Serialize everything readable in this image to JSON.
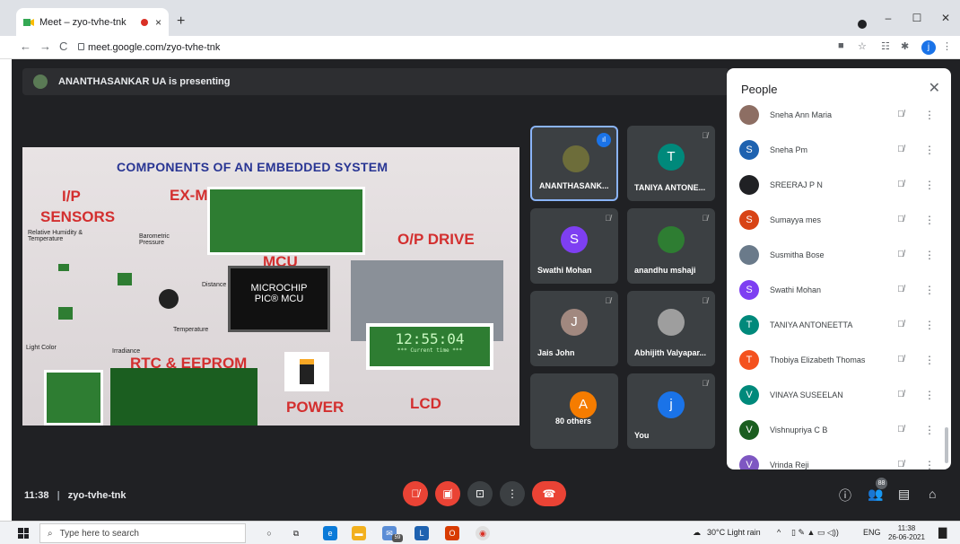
{
  "browser": {
    "tab_title": "Meet – zyo-tvhe-tnk",
    "tab_close": "×",
    "new_tab": "+",
    "url": "meet.google.com/zyo-tvhe-tnk",
    "profile_initial": "j",
    "win_min": "–",
    "win_max": "☐",
    "win_close": "✕"
  },
  "meeting": {
    "presenting_text": "ANANTHASANKAR UA is presenting",
    "time": "11:38",
    "code": "zyo-tvhe-tnk",
    "participants_badge": "88"
  },
  "slide": {
    "heading": "COMPONENTS OF AN EMBEDDED SYSTEM",
    "labels": {
      "ip": "I/P",
      "sensors": "SENSORS",
      "ex_modules": "EX-MODULES",
      "op_drive": "O/P DRIVE",
      "mcu": "MCU",
      "rtc": "RTC & EEPROM",
      "power": "POWER",
      "lcd": "LCD"
    },
    "small": {
      "humidity": "Relative Humidity & Temperature",
      "barometric": "Barometric Pressure",
      "distance": "Distance",
      "temperature": "Temperature",
      "light": "Light Color",
      "irradiance": "Irradiance"
    },
    "chip_brand": "MICROCHIP",
    "chip_name": "PIC® MCU",
    "lcd_time": "12:55:04",
    "lcd_sub": "*** Current time ***"
  },
  "tiles": [
    {
      "name": "ANANTHASANK...",
      "initial": "",
      "color": "#6d6d3a"
    },
    {
      "name": "TANIYA ANTONE...",
      "initial": "T",
      "color": "#00897b"
    },
    {
      "name": "Swathi Mohan",
      "initial": "S",
      "color": "#7e3ff2"
    },
    {
      "name": "anandhu mshaji",
      "initial": "",
      "color": "#2e7d32"
    },
    {
      "name": "Jais John",
      "initial": "J",
      "color": "#a1887f"
    },
    {
      "name": "Abhijith Valyapar...",
      "initial": "",
      "color": "#9e9e9e"
    },
    {
      "name": "80 others",
      "initial": "A",
      "color": "#f57c00"
    },
    {
      "name": "You",
      "initial": "j",
      "color": "#1a73e8"
    }
  ],
  "people_panel": {
    "title": "People",
    "close": "✕",
    "list": [
      {
        "name": "Sneha Ann Maria",
        "initial": "",
        "color": "#8d6e63"
      },
      {
        "name": "Sneha Pm",
        "initial": "S",
        "color": "#1e62b0"
      },
      {
        "name": "SREERAJ P N",
        "initial": "",
        "color": "#202124"
      },
      {
        "name": "Sumayya mes",
        "initial": "S",
        "color": "#d84315"
      },
      {
        "name": "Susmitha Bose",
        "initial": "",
        "color": "#6a7a8a"
      },
      {
        "name": "Swathi Mohan",
        "initial": "S",
        "color": "#7e3ff2"
      },
      {
        "name": "TANIYA ANTONEETTA",
        "initial": "T",
        "color": "#00897b"
      },
      {
        "name": "Thobiya Elizabeth Thomas",
        "initial": "T",
        "color": "#f4511e"
      },
      {
        "name": "VINAYA SUSEELAN",
        "initial": "V",
        "color": "#00897b"
      },
      {
        "name": "Vishnupriya C B",
        "initial": "V",
        "color": "#1b5e20"
      },
      {
        "name": "Vrinda Reji",
        "initial": "V",
        "color": "#7e57c2"
      }
    ]
  },
  "taskbar": {
    "search_placeholder": "Type here to search",
    "weather": "30°C  Light rain",
    "lang": "ENG",
    "clock_time": "11:38",
    "clock_date": "26-06-2021",
    "mail_count": "59"
  }
}
